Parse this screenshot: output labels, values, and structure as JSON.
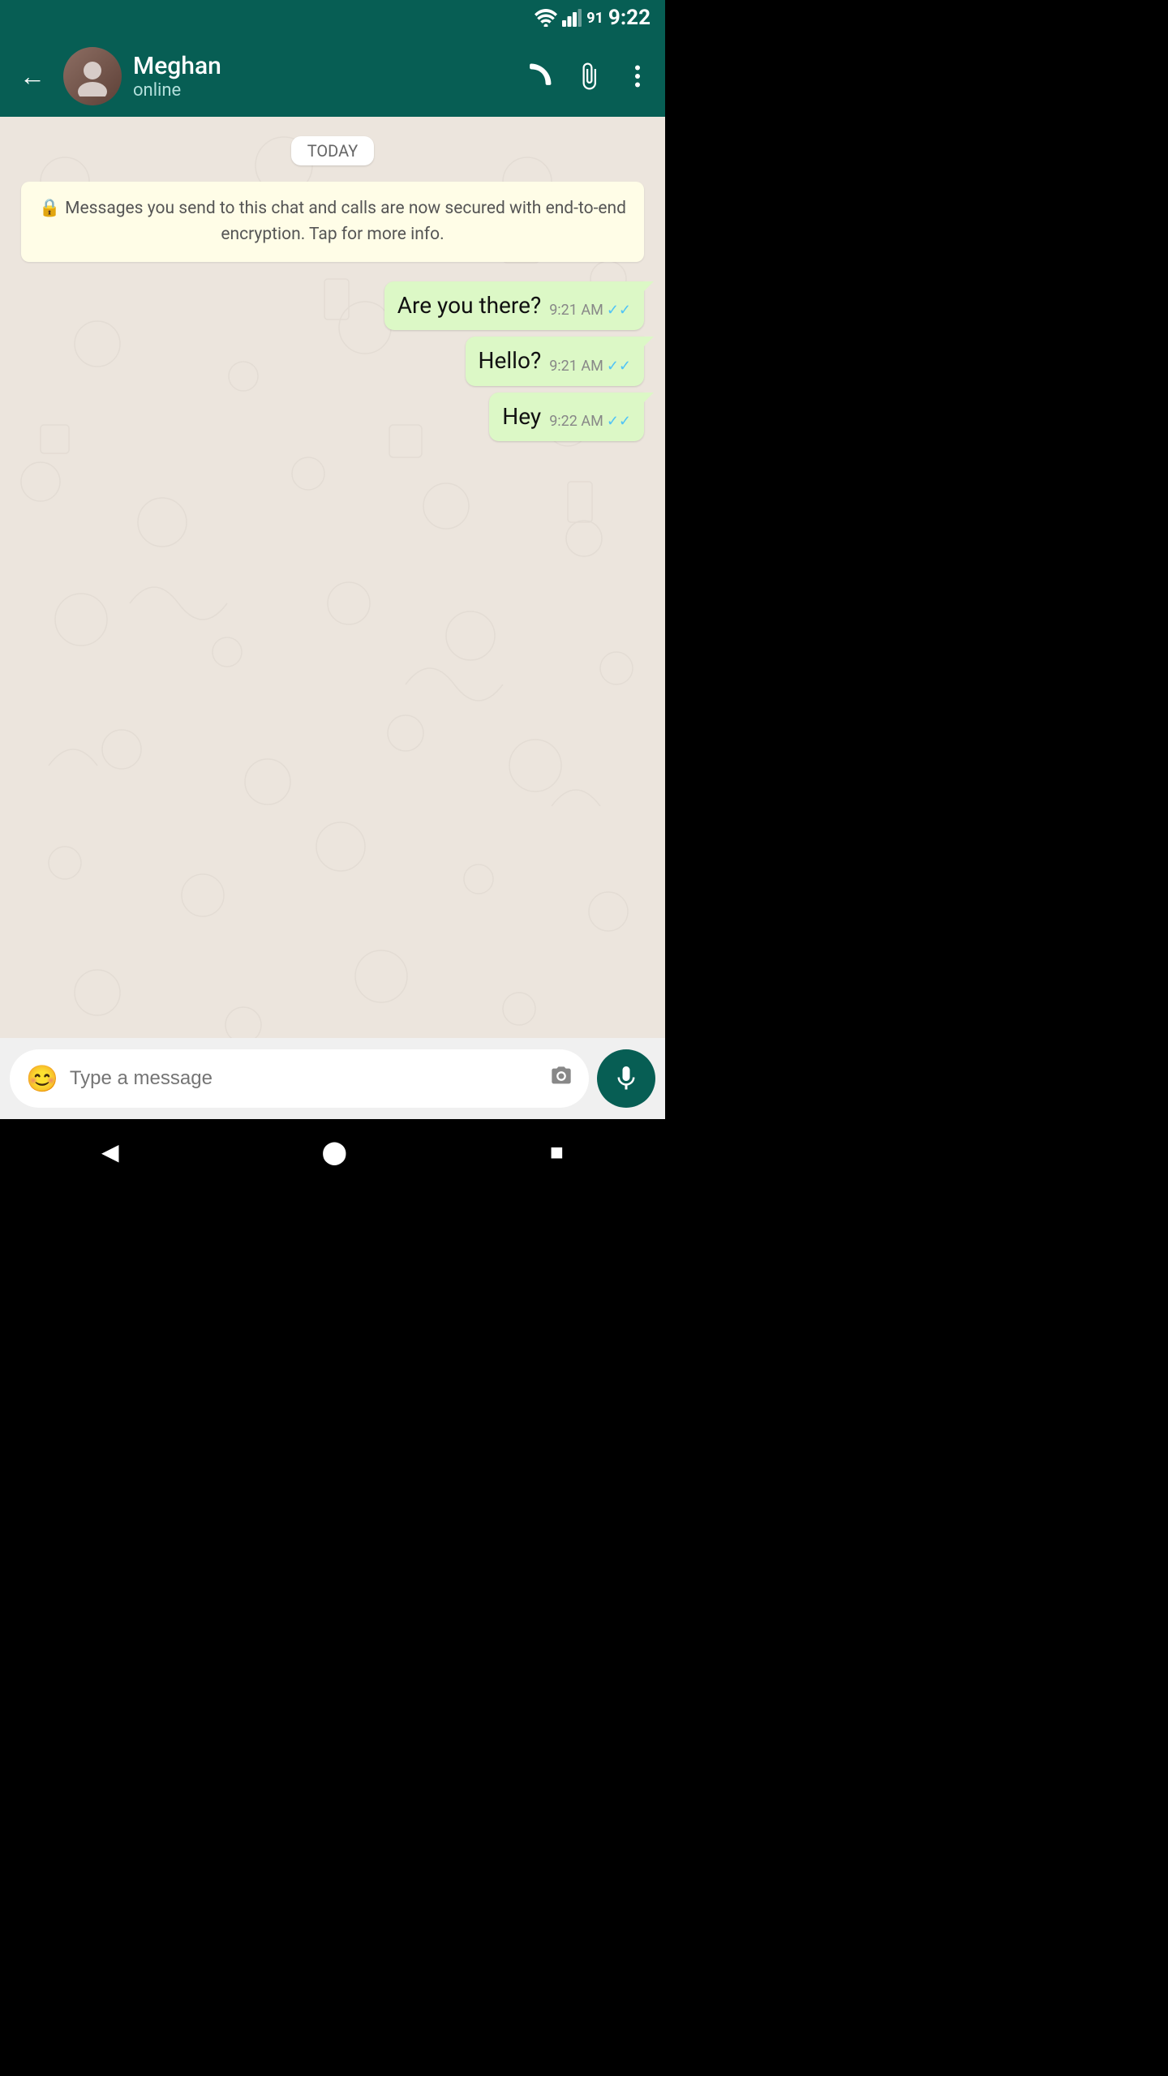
{
  "statusBar": {
    "time": "9:22",
    "batteryLevel": "91"
  },
  "header": {
    "backLabel": "←",
    "contactName": "Meghan",
    "contactStatus": "online",
    "phoneIconLabel": "phone-icon",
    "attachIconLabel": "attach-icon",
    "moreIconLabel": "more-icon"
  },
  "chat": {
    "dateBadge": "TODAY",
    "securityNotice": "Messages you send to this chat and calls are now secured with end-to-end encryption. Tap for more info.",
    "messages": [
      {
        "id": 1,
        "text": "Are you there?",
        "time": "9:21 AM",
        "status": "read"
      },
      {
        "id": 2,
        "text": "Hello?",
        "time": "9:21 AM",
        "status": "read"
      },
      {
        "id": 3,
        "text": "Hey",
        "time": "9:22 AM",
        "status": "read"
      }
    ]
  },
  "inputBar": {
    "placeholder": "Type a message",
    "emojiIconLabel": "emoji-icon",
    "cameraIconLabel": "camera-icon",
    "micIconLabel": "mic-icon"
  },
  "bottomNav": {
    "backLabel": "◀",
    "homeLabel": "⬤",
    "recentLabel": "■"
  }
}
